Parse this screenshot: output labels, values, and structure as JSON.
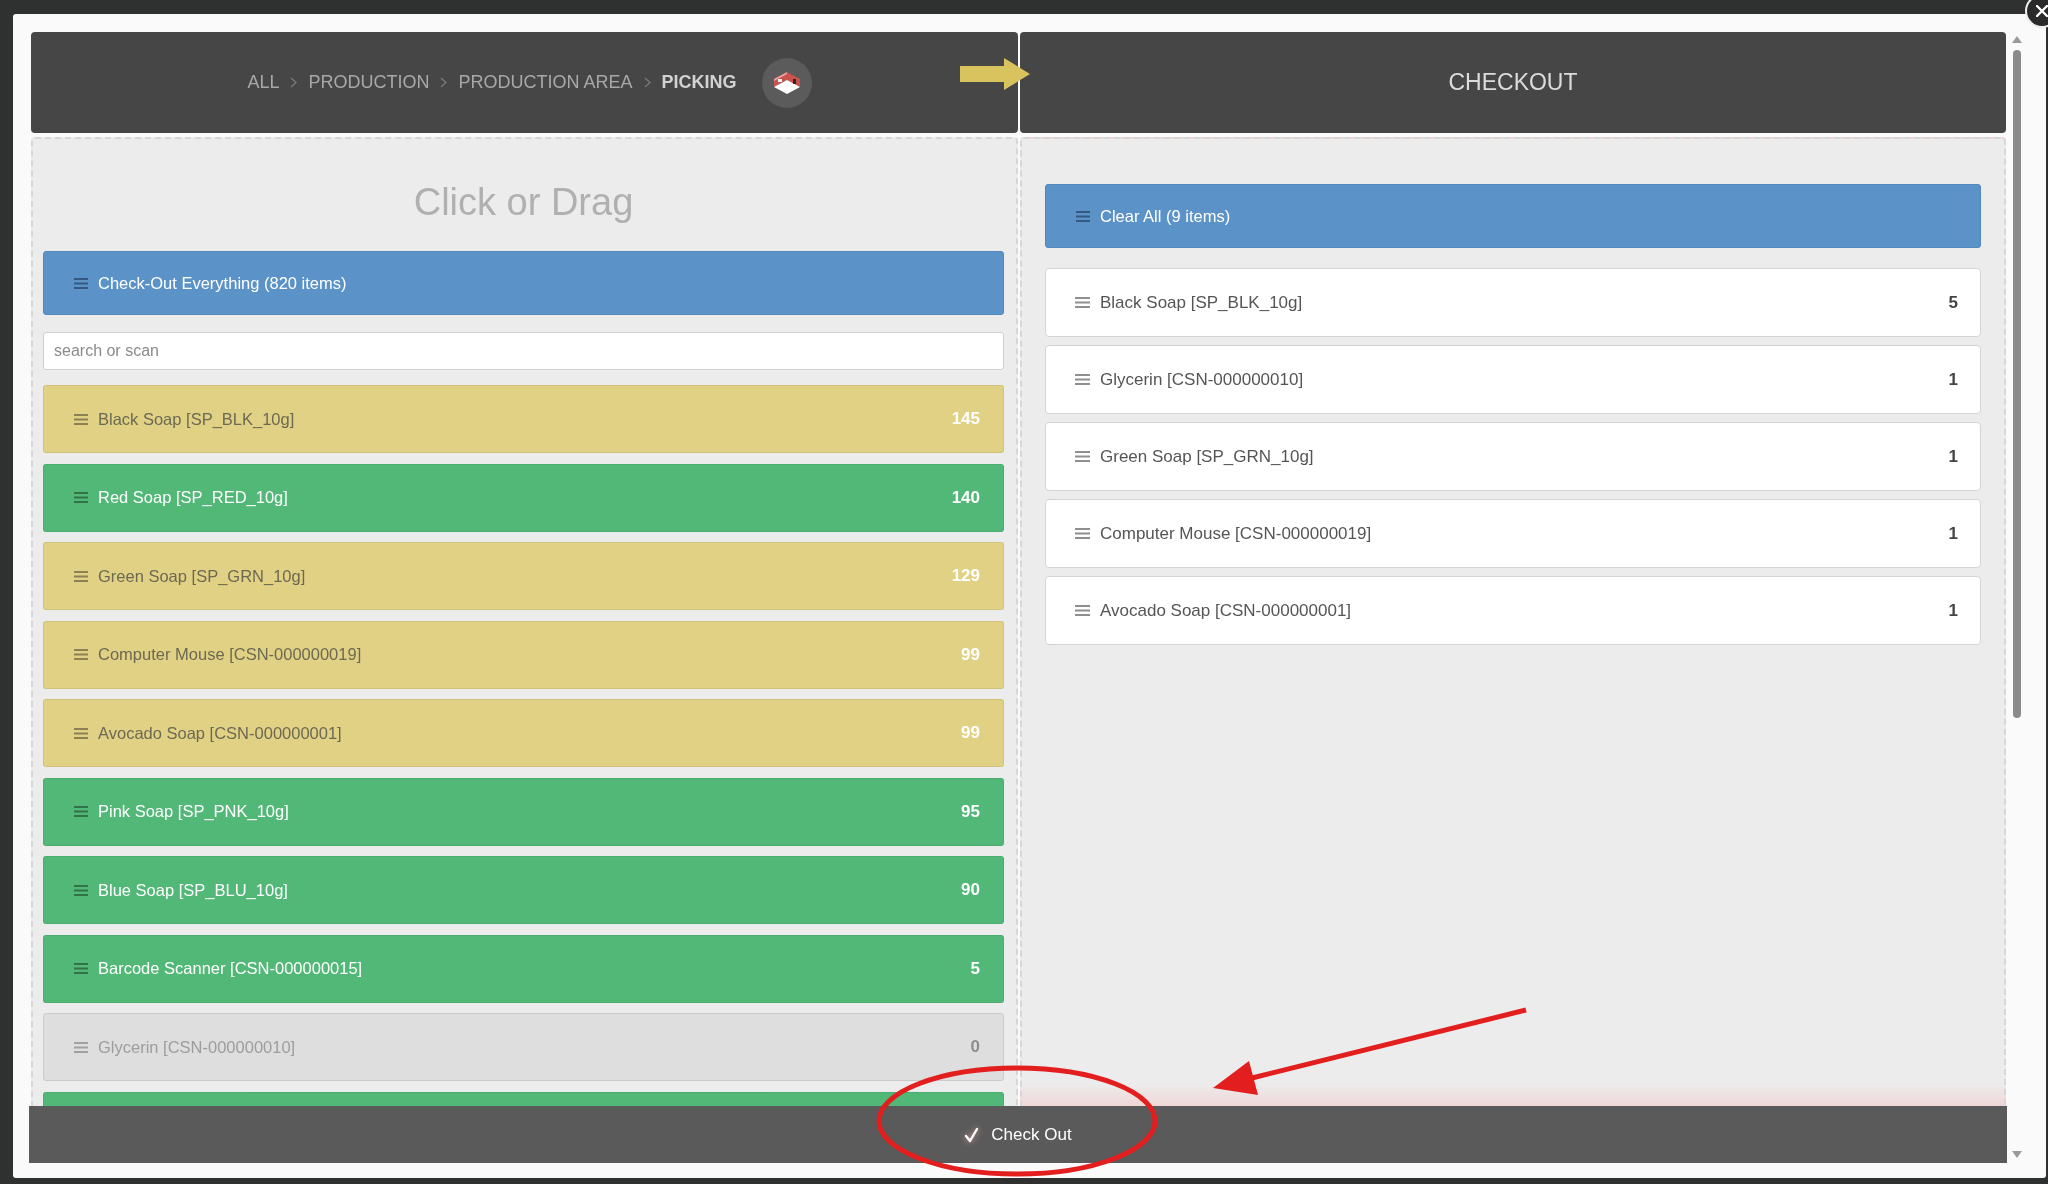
{
  "header": {
    "breadcrumb": [
      {
        "label": "ALL",
        "current": false
      },
      {
        "label": "PRODUCTION",
        "current": false
      },
      {
        "label": "PRODUCTION AREA",
        "current": false
      },
      {
        "label": "PICKING",
        "current": true
      }
    ],
    "checkout_title": "CHECKOUT"
  },
  "source": {
    "title": "Click or Drag",
    "checkout_all": "Check-Out Everything (820 items)",
    "search": {
      "placeholder": "search or scan"
    },
    "items": [
      {
        "label": "Black Soap [SP_BLK_10g]",
        "count": "145",
        "color": "#e1d185",
        "disabled": false
      },
      {
        "label": "Red Soap [SP_RED_10g]",
        "count": "140",
        "color": "#52b877",
        "disabled": false
      },
      {
        "label": "Green Soap [SP_GRN_10g]",
        "count": "129",
        "color": "#e1d185",
        "disabled": false
      },
      {
        "label": "Computer Mouse [CSN-000000019]",
        "count": "99",
        "color": "#e1d185",
        "disabled": false
      },
      {
        "label": "Avocado Soap [CSN-000000001]",
        "count": "99",
        "color": "#e1d185",
        "disabled": false
      },
      {
        "label": "Pink Soap [SP_PNK_10g]",
        "count": "95",
        "color": "#52b877",
        "disabled": false
      },
      {
        "label": "Blue Soap [SP_BLU_10g]",
        "count": "90",
        "color": "#52b877",
        "disabled": false
      },
      {
        "label": "Barcode Scanner [CSN-000000015]",
        "count": "5",
        "color": "#52b877",
        "disabled": false
      },
      {
        "label": "Glycerin [CSN-000000010]",
        "count": "0",
        "color": "#dedede",
        "disabled": true
      },
      {
        "color": "#52b877"
      }
    ]
  },
  "checkout": {
    "clear_all": "Clear All (9 items)",
    "items": [
      {
        "label": "Black Soap [SP_BLK_10g]",
        "count": "5"
      },
      {
        "label": "Glycerin [CSN-000000010]",
        "count": "1"
      },
      {
        "label": "Green Soap [SP_GRN_10g]",
        "count": "1"
      },
      {
        "label": "Computer Mouse [CSN-000000019]",
        "count": "1"
      },
      {
        "label": "Avocado Soap [CSN-000000001]",
        "count": "1"
      }
    ]
  },
  "footer": {
    "button": "Check Out"
  }
}
